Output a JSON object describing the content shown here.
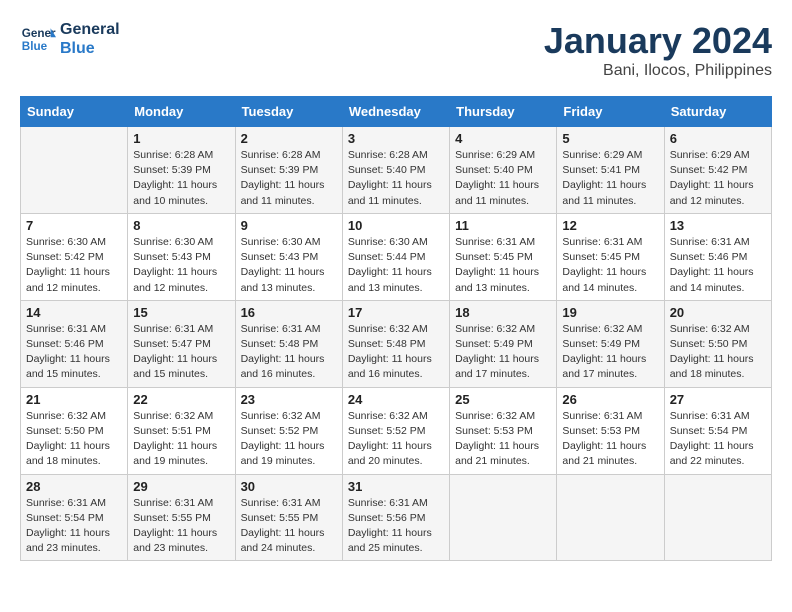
{
  "header": {
    "logo_line1": "General",
    "logo_line2": "Blue",
    "month": "January 2024",
    "location": "Bani, Ilocos, Philippines"
  },
  "days_of_week": [
    "Sunday",
    "Monday",
    "Tuesday",
    "Wednesday",
    "Thursday",
    "Friday",
    "Saturday"
  ],
  "weeks": [
    [
      {
        "day": "",
        "info": ""
      },
      {
        "day": "1",
        "info": "Sunrise: 6:28 AM\nSunset: 5:39 PM\nDaylight: 11 hours\nand 10 minutes."
      },
      {
        "day": "2",
        "info": "Sunrise: 6:28 AM\nSunset: 5:39 PM\nDaylight: 11 hours\nand 11 minutes."
      },
      {
        "day": "3",
        "info": "Sunrise: 6:28 AM\nSunset: 5:40 PM\nDaylight: 11 hours\nand 11 minutes."
      },
      {
        "day": "4",
        "info": "Sunrise: 6:29 AM\nSunset: 5:40 PM\nDaylight: 11 hours\nand 11 minutes."
      },
      {
        "day": "5",
        "info": "Sunrise: 6:29 AM\nSunset: 5:41 PM\nDaylight: 11 hours\nand 11 minutes."
      },
      {
        "day": "6",
        "info": "Sunrise: 6:29 AM\nSunset: 5:42 PM\nDaylight: 11 hours\nand 12 minutes."
      }
    ],
    [
      {
        "day": "7",
        "info": "Sunrise: 6:30 AM\nSunset: 5:42 PM\nDaylight: 11 hours\nand 12 minutes."
      },
      {
        "day": "8",
        "info": "Sunrise: 6:30 AM\nSunset: 5:43 PM\nDaylight: 11 hours\nand 12 minutes."
      },
      {
        "day": "9",
        "info": "Sunrise: 6:30 AM\nSunset: 5:43 PM\nDaylight: 11 hours\nand 13 minutes."
      },
      {
        "day": "10",
        "info": "Sunrise: 6:30 AM\nSunset: 5:44 PM\nDaylight: 11 hours\nand 13 minutes."
      },
      {
        "day": "11",
        "info": "Sunrise: 6:31 AM\nSunset: 5:45 PM\nDaylight: 11 hours\nand 13 minutes."
      },
      {
        "day": "12",
        "info": "Sunrise: 6:31 AM\nSunset: 5:45 PM\nDaylight: 11 hours\nand 14 minutes."
      },
      {
        "day": "13",
        "info": "Sunrise: 6:31 AM\nSunset: 5:46 PM\nDaylight: 11 hours\nand 14 minutes."
      }
    ],
    [
      {
        "day": "14",
        "info": "Sunrise: 6:31 AM\nSunset: 5:46 PM\nDaylight: 11 hours\nand 15 minutes."
      },
      {
        "day": "15",
        "info": "Sunrise: 6:31 AM\nSunset: 5:47 PM\nDaylight: 11 hours\nand 15 minutes."
      },
      {
        "day": "16",
        "info": "Sunrise: 6:31 AM\nSunset: 5:48 PM\nDaylight: 11 hours\nand 16 minutes."
      },
      {
        "day": "17",
        "info": "Sunrise: 6:32 AM\nSunset: 5:48 PM\nDaylight: 11 hours\nand 16 minutes."
      },
      {
        "day": "18",
        "info": "Sunrise: 6:32 AM\nSunset: 5:49 PM\nDaylight: 11 hours\nand 17 minutes."
      },
      {
        "day": "19",
        "info": "Sunrise: 6:32 AM\nSunset: 5:49 PM\nDaylight: 11 hours\nand 17 minutes."
      },
      {
        "day": "20",
        "info": "Sunrise: 6:32 AM\nSunset: 5:50 PM\nDaylight: 11 hours\nand 18 minutes."
      }
    ],
    [
      {
        "day": "21",
        "info": "Sunrise: 6:32 AM\nSunset: 5:50 PM\nDaylight: 11 hours\nand 18 minutes."
      },
      {
        "day": "22",
        "info": "Sunrise: 6:32 AM\nSunset: 5:51 PM\nDaylight: 11 hours\nand 19 minutes."
      },
      {
        "day": "23",
        "info": "Sunrise: 6:32 AM\nSunset: 5:52 PM\nDaylight: 11 hours\nand 19 minutes."
      },
      {
        "day": "24",
        "info": "Sunrise: 6:32 AM\nSunset: 5:52 PM\nDaylight: 11 hours\nand 20 minutes."
      },
      {
        "day": "25",
        "info": "Sunrise: 6:32 AM\nSunset: 5:53 PM\nDaylight: 11 hours\nand 21 minutes."
      },
      {
        "day": "26",
        "info": "Sunrise: 6:31 AM\nSunset: 5:53 PM\nDaylight: 11 hours\nand 21 minutes."
      },
      {
        "day": "27",
        "info": "Sunrise: 6:31 AM\nSunset: 5:54 PM\nDaylight: 11 hours\nand 22 minutes."
      }
    ],
    [
      {
        "day": "28",
        "info": "Sunrise: 6:31 AM\nSunset: 5:54 PM\nDaylight: 11 hours\nand 23 minutes."
      },
      {
        "day": "29",
        "info": "Sunrise: 6:31 AM\nSunset: 5:55 PM\nDaylight: 11 hours\nand 23 minutes."
      },
      {
        "day": "30",
        "info": "Sunrise: 6:31 AM\nSunset: 5:55 PM\nDaylight: 11 hours\nand 24 minutes."
      },
      {
        "day": "31",
        "info": "Sunrise: 6:31 AM\nSunset: 5:56 PM\nDaylight: 11 hours\nand 25 minutes."
      },
      {
        "day": "",
        "info": ""
      },
      {
        "day": "",
        "info": ""
      },
      {
        "day": "",
        "info": ""
      }
    ]
  ]
}
